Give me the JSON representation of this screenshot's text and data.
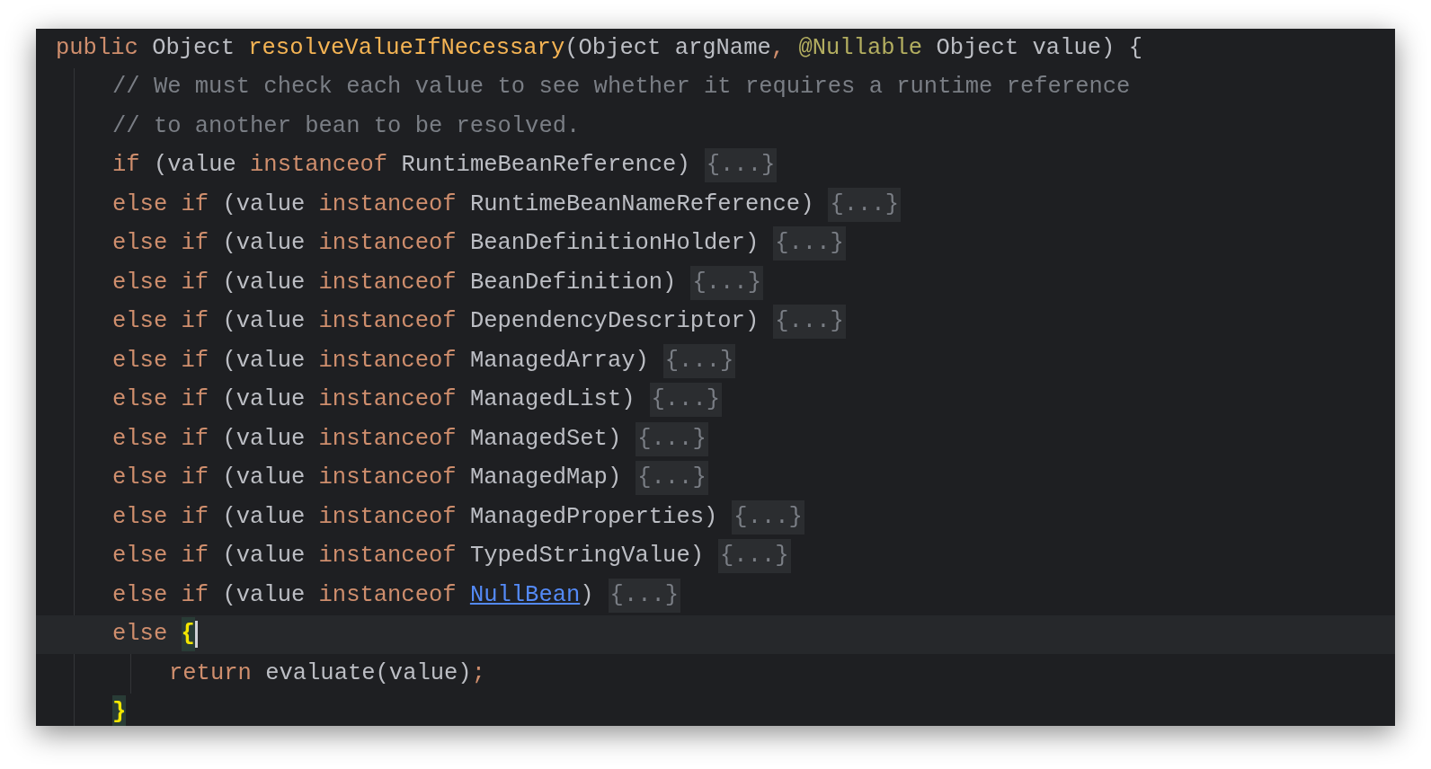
{
  "editor": {
    "lines": [
      {
        "current": false,
        "tokens": [
          {
            "text": "public ",
            "kind": "keyword"
          },
          {
            "text": "Object ",
            "kind": "plain"
          },
          {
            "text": "resolveValueIfNecessary",
            "kind": "function"
          },
          {
            "text": "(Object argName",
            "kind": "plain"
          },
          {
            "text": ", ",
            "kind": "keyword"
          },
          {
            "text": "@Nullable ",
            "kind": "annotation"
          },
          {
            "text": "Object value) {",
            "kind": "plain"
          }
        ],
        "children": [
          {
            "current": false,
            "tokens": [
              {
                "text": "// We must check each value to see whether it requires a runtime reference",
                "kind": "comment"
              }
            ]
          },
          {
            "current": false,
            "tokens": [
              {
                "text": "// to another bean to be resolved.",
                "kind": "comment"
              }
            ]
          },
          {
            "current": false,
            "tokens": [
              {
                "text": "if ",
                "kind": "keyword"
              },
              {
                "text": "(value ",
                "kind": "plain"
              },
              {
                "text": "instanceof ",
                "kind": "keyword"
              },
              {
                "text": "RuntimeBeanReference)",
                "kind": "plain"
              },
              {
                "text": "{...}",
                "kind": "fold"
              }
            ]
          },
          {
            "current": false,
            "tokens": [
              {
                "text": "else if ",
                "kind": "keyword"
              },
              {
                "text": "(value ",
                "kind": "plain"
              },
              {
                "text": "instanceof ",
                "kind": "keyword"
              },
              {
                "text": "RuntimeBeanNameReference)",
                "kind": "plain"
              },
              {
                "text": "{...}",
                "kind": "fold"
              }
            ]
          },
          {
            "current": false,
            "tokens": [
              {
                "text": "else if ",
                "kind": "keyword"
              },
              {
                "text": "(value ",
                "kind": "plain"
              },
              {
                "text": "instanceof ",
                "kind": "keyword"
              },
              {
                "text": "BeanDefinitionHolder)",
                "kind": "plain"
              },
              {
                "text": "{...}",
                "kind": "fold"
              }
            ]
          },
          {
            "current": false,
            "tokens": [
              {
                "text": "else if ",
                "kind": "keyword"
              },
              {
                "text": "(value ",
                "kind": "plain"
              },
              {
                "text": "instanceof ",
                "kind": "keyword"
              },
              {
                "text": "BeanDefinition)",
                "kind": "plain"
              },
              {
                "text": "{...}",
                "kind": "fold"
              }
            ]
          },
          {
            "current": false,
            "tokens": [
              {
                "text": "else if ",
                "kind": "keyword"
              },
              {
                "text": "(value ",
                "kind": "plain"
              },
              {
                "text": "instanceof ",
                "kind": "keyword"
              },
              {
                "text": "DependencyDescriptor)",
                "kind": "plain"
              },
              {
                "text": "{...}",
                "kind": "fold"
              }
            ]
          },
          {
            "current": false,
            "tokens": [
              {
                "text": "else if ",
                "kind": "keyword"
              },
              {
                "text": "(value ",
                "kind": "plain"
              },
              {
                "text": "instanceof ",
                "kind": "keyword"
              },
              {
                "text": "ManagedArray)",
                "kind": "plain"
              },
              {
                "text": "{...}",
                "kind": "fold"
              }
            ]
          },
          {
            "current": false,
            "tokens": [
              {
                "text": "else if ",
                "kind": "keyword"
              },
              {
                "text": "(value ",
                "kind": "plain"
              },
              {
                "text": "instanceof ",
                "kind": "keyword"
              },
              {
                "text": "ManagedList)",
                "kind": "plain"
              },
              {
                "text": "{...}",
                "kind": "fold"
              }
            ]
          },
          {
            "current": false,
            "tokens": [
              {
                "text": "else if ",
                "kind": "keyword"
              },
              {
                "text": "(value ",
                "kind": "plain"
              },
              {
                "text": "instanceof ",
                "kind": "keyword"
              },
              {
                "text": "ManagedSet)",
                "kind": "plain"
              },
              {
                "text": "{...}",
                "kind": "fold"
              }
            ]
          },
          {
            "current": false,
            "tokens": [
              {
                "text": "else if ",
                "kind": "keyword"
              },
              {
                "text": "(value ",
                "kind": "plain"
              },
              {
                "text": "instanceof ",
                "kind": "keyword"
              },
              {
                "text": "ManagedMap)",
                "kind": "plain"
              },
              {
                "text": "{...}",
                "kind": "fold"
              }
            ]
          },
          {
            "current": false,
            "tokens": [
              {
                "text": "else if ",
                "kind": "keyword"
              },
              {
                "text": "(value ",
                "kind": "plain"
              },
              {
                "text": "instanceof ",
                "kind": "keyword"
              },
              {
                "text": "ManagedProperties)",
                "kind": "plain"
              },
              {
                "text": "{...}",
                "kind": "fold"
              }
            ]
          },
          {
            "current": false,
            "tokens": [
              {
                "text": "else if ",
                "kind": "keyword"
              },
              {
                "text": "(value ",
                "kind": "plain"
              },
              {
                "text": "instanceof ",
                "kind": "keyword"
              },
              {
                "text": "TypedStringValue)",
                "kind": "plain"
              },
              {
                "text": "{...}",
                "kind": "fold"
              }
            ]
          },
          {
            "current": false,
            "tokens": [
              {
                "text": "else if ",
                "kind": "keyword"
              },
              {
                "text": "(value ",
                "kind": "plain"
              },
              {
                "text": "instanceof ",
                "kind": "keyword"
              },
              {
                "text": "NullBean",
                "kind": "link"
              },
              {
                "text": ")",
                "kind": "plain"
              },
              {
                "text": "{...}",
                "kind": "fold"
              }
            ]
          },
          {
            "current": true,
            "tokens": [
              {
                "text": "else ",
                "kind": "keyword"
              },
              {
                "text": "{",
                "kind": "brace_match",
                "caret": true
              }
            ],
            "children": [
              {
                "current": false,
                "tokens": [
                  {
                    "text": "return ",
                    "kind": "keyword"
                  },
                  {
                    "text": "evaluate(value)",
                    "kind": "plain"
                  },
                  {
                    "text": ";",
                    "kind": "keyword"
                  }
                ]
              }
            ]
          },
          {
            "current": false,
            "tokens": [
              {
                "text": "}",
                "kind": "brace_match",
                "caret": false
              }
            ]
          }
        ]
      }
    ]
  }
}
